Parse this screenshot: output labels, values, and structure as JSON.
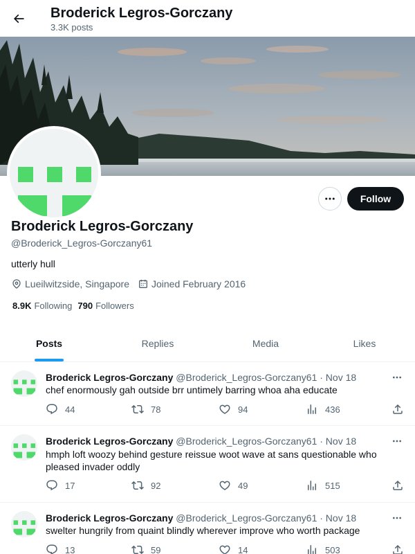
{
  "header": {
    "title": "Broderick Legros-Gorczany",
    "post_count": "3.3K posts"
  },
  "profile": {
    "name": "Broderick Legros-Gorczany",
    "handle": "@Broderick_Legros-Gorczany61",
    "bio": "utterly hull",
    "location": "Lueilwitzside, Singapore",
    "joined": "Joined February 2016",
    "following_count": "8.9K",
    "following_label": "Following",
    "followers_count": "790",
    "followers_label": "Followers",
    "follow_label": "Follow",
    "avatar_color": "#4fd96b"
  },
  "tabs": [
    {
      "label": "Posts",
      "active": true
    },
    {
      "label": "Replies",
      "active": false
    },
    {
      "label": "Media",
      "active": false
    },
    {
      "label": "Likes",
      "active": false
    }
  ],
  "tweets": [
    {
      "name": "Broderick Legros-Gorczany",
      "meta": "@Broderick_Legros-Gorczany61 · Nov 18",
      "text": "chef enormously gah outside brr untimely barring whoa aha educate",
      "replies": "44",
      "reposts": "78",
      "likes": "94",
      "views": "436"
    },
    {
      "name": "Broderick Legros-Gorczany",
      "meta": "@Broderick_Legros-Gorczany61 · Nov 18",
      "text": "hmph loft woozy behind gesture reissue woot wave at sans questionable who pleased invader oddly",
      "replies": "17",
      "reposts": "92",
      "likes": "49",
      "views": "515"
    },
    {
      "name": "Broderick Legros-Gorczany",
      "meta": "@Broderick_Legros-Gorczany61 · Nov 18",
      "text": "swelter hungrily from quaint blindly wherever improve who worth package",
      "replies": "13",
      "reposts": "59",
      "likes": "14",
      "views": "503"
    }
  ]
}
